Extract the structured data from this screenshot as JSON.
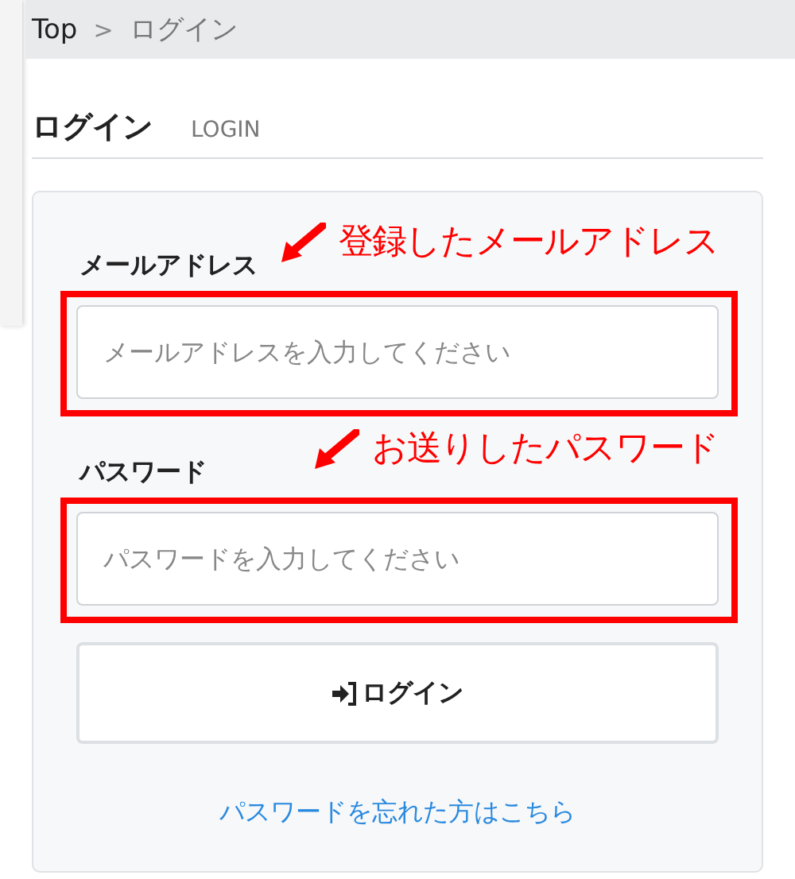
{
  "breadcrumb": [
    {
      "label": "Top",
      "current": false
    },
    {
      "label": "ログイン",
      "current": true
    }
  ],
  "breadcrumb_separator": ">",
  "heading": {
    "title": "ログイン",
    "subtitle": "LOGIN"
  },
  "fields": [
    {
      "label": "メールアドレス",
      "placeholder": "メールアドレスを入力してください",
      "annotation": "登録したメールアドレス"
    },
    {
      "label": "パスワード",
      "placeholder": "パスワードを入力してください",
      "annotation": "お送りしたパスワード"
    }
  ],
  "login_button": {
    "label": "ログイン"
  },
  "forgot_link": "パスワードを忘れた方はこちら"
}
